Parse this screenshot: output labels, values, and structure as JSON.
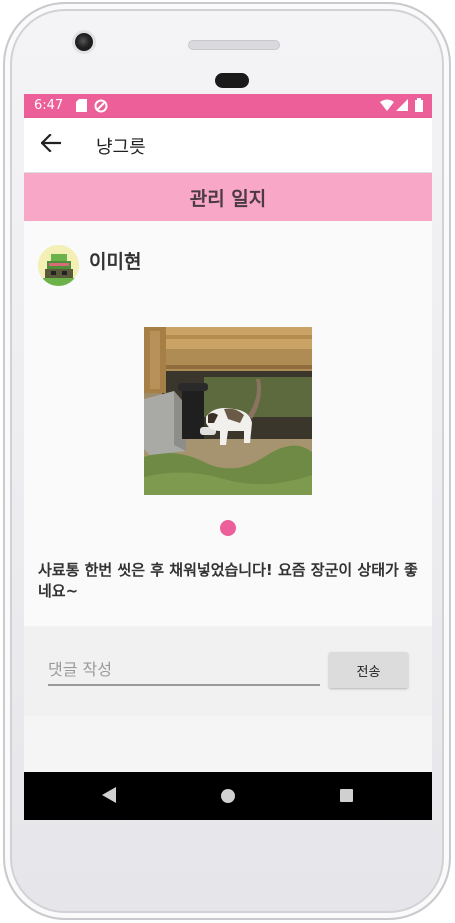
{
  "status_bar": {
    "time": "6:47",
    "icons": [
      "sd-card-icon",
      "sync-icon",
      "wifi-icon",
      "signal-icon",
      "battery-icon"
    ],
    "color": "#ec5f98"
  },
  "app_bar": {
    "back_icon": "arrow-back-icon",
    "title": "냥그릇"
  },
  "section": {
    "title": "관리 일지",
    "color": "#f9a7c6"
  },
  "post": {
    "author": "이미현",
    "photo_description_icon": "cat-photo",
    "page_indicator": {
      "current": 1,
      "total": 1
    },
    "text": "사료통 한번 씻은 후 채워넣었습니다! 요즘 장군이 상태가 좋네요~"
  },
  "comment": {
    "placeholder": "댓글 작성",
    "value": "",
    "send_label": "전송"
  },
  "nav_bar": {
    "icons": [
      "back-triangle-icon",
      "home-circle-icon",
      "recents-square-icon"
    ]
  }
}
